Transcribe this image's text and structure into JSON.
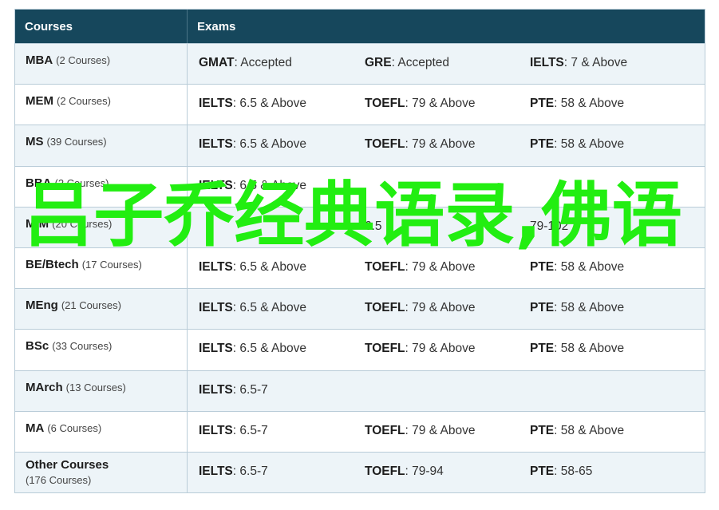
{
  "header": {
    "courses_label": "Courses",
    "exams_label": "Exams"
  },
  "rows": [
    {
      "course": "MBA",
      "count": "(2 Courses)",
      "exams": [
        {
          "name": "GMAT",
          "value": "Accepted"
        },
        {
          "name": "GRE",
          "value": "Accepted"
        },
        {
          "name": "IELTS",
          "value": "7 & Above"
        }
      ]
    },
    {
      "course": "MEM",
      "count": "(2 Courses)",
      "exams": [
        {
          "name": "IELTS",
          "value": "6.5 & Above"
        },
        {
          "name": "TOEFL",
          "value": "79 & Above"
        },
        {
          "name": "PTE",
          "value": "58 & Above"
        }
      ]
    },
    {
      "course": "MS",
      "count": "(39 Courses)",
      "exams": [
        {
          "name": "IELTS",
          "value": "6.5 & Above"
        },
        {
          "name": "TOEFL",
          "value": "79 & Above"
        },
        {
          "name": "PTE",
          "value": "58 & Above"
        }
      ]
    },
    {
      "course": "BBA",
      "count": "(2 Courses)",
      "exams": [
        {
          "name": "IELTS",
          "value": "6.5 & Above"
        },
        {
          "name": "",
          "value": ""
        },
        {
          "name": "",
          "value": ""
        }
      ]
    },
    {
      "course": "MIM",
      "count": "(20 Courses)",
      "exams": [
        {
          "name": "",
          "value": ""
        },
        {
          "name": "",
          "value": "6.5"
        },
        {
          "name": "",
          "value": "79-102"
        }
      ]
    },
    {
      "course": "BE/Btech",
      "count": "(17 Courses)",
      "exams": [
        {
          "name": "IELTS",
          "value": "6.5 & Above"
        },
        {
          "name": "TOEFL",
          "value": "79 & Above"
        },
        {
          "name": "PTE",
          "value": "58 & Above"
        }
      ]
    },
    {
      "course": "MEng",
      "count": "(21 Courses)",
      "exams": [
        {
          "name": "IELTS",
          "value": "6.5 & Above"
        },
        {
          "name": "TOEFL",
          "value": "79 & Above"
        },
        {
          "name": "PTE",
          "value": "58 & Above"
        }
      ]
    },
    {
      "course": "BSc",
      "count": "(33 Courses)",
      "exams": [
        {
          "name": "IELTS",
          "value": "6.5 & Above"
        },
        {
          "name": "TOEFL",
          "value": "79 & Above"
        },
        {
          "name": "PTE",
          "value": "58 & Above"
        }
      ]
    },
    {
      "course": "MArch",
      "count": "(13 Courses)",
      "exams": [
        {
          "name": "IELTS",
          "value": "6.5-7"
        },
        {
          "name": "",
          "value": ""
        },
        {
          "name": "",
          "value": ""
        }
      ]
    },
    {
      "course": "MA",
      "count": "(6 Courses)",
      "exams": [
        {
          "name": "IELTS",
          "value": "6.5-7"
        },
        {
          "name": "TOEFL",
          "value": "79 & Above"
        },
        {
          "name": "PTE",
          "value": "58 & Above"
        }
      ]
    },
    {
      "course": "Other Courses",
      "count": "(176 Courses)",
      "exams": [
        {
          "name": "IELTS",
          "value": "6.5-7"
        },
        {
          "name": "TOEFL",
          "value": "79-94"
        },
        {
          "name": "PTE",
          "value": "58-65"
        }
      ]
    }
  ],
  "watermark": {
    "text": "吕子乔经典语录,佛语",
    "color": "#22ee11"
  }
}
